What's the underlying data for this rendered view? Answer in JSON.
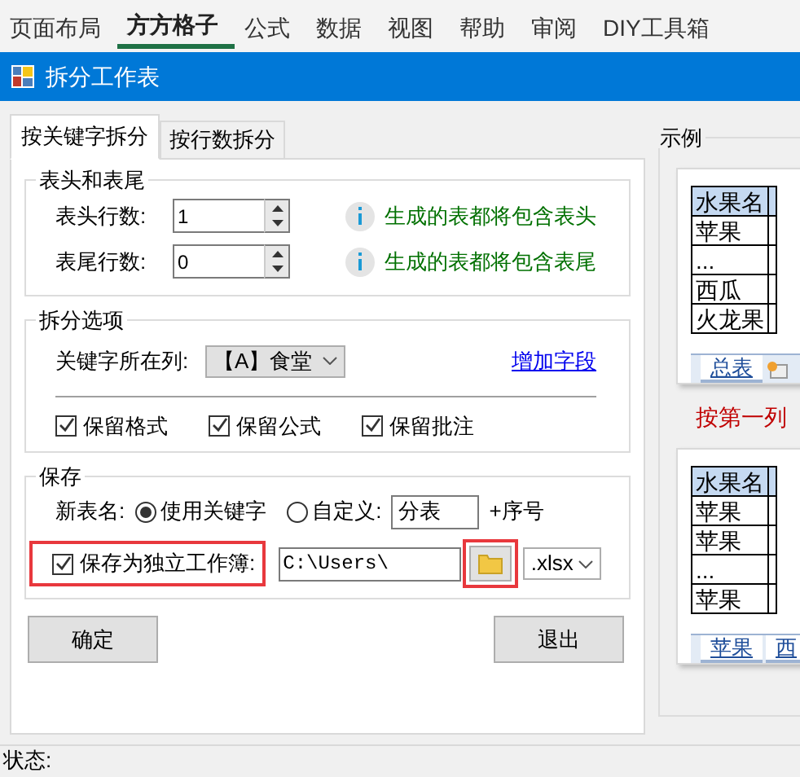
{
  "ribbon_tabs": [
    {
      "label": "页面布局",
      "selected": false
    },
    {
      "label": "方方格子",
      "selected": true
    },
    {
      "label": "公式",
      "selected": false
    },
    {
      "label": "数据",
      "selected": false
    },
    {
      "label": "视图",
      "selected": false
    },
    {
      "label": "帮助",
      "selected": false
    },
    {
      "label": "审阅",
      "selected": false
    },
    {
      "label": "DIY工具箱",
      "selected": false
    }
  ],
  "dialog": {
    "title": "拆分工作表"
  },
  "tabs": [
    {
      "label": "按关键字拆分",
      "selected": true
    },
    {
      "label": "按行数拆分",
      "selected": false
    }
  ],
  "header_footer": {
    "title": "表头和表尾",
    "rows": [
      {
        "label": "表头行数:",
        "value": "1",
        "hint": "生成的表都将包含表头"
      },
      {
        "label": "表尾行数:",
        "value": "0",
        "hint": "生成的表都将包含表尾"
      }
    ]
  },
  "split_options": {
    "title": "拆分选项",
    "key_column_label": "关键字所在列:",
    "key_column_value": "【A】食堂",
    "add_field_link": "增加字段",
    "checkboxes": [
      {
        "label": "保留格式",
        "checked": true
      },
      {
        "label": "保留公式",
        "checked": true
      },
      {
        "label": "保留批注",
        "checked": true
      }
    ]
  },
  "save": {
    "title": "保存",
    "new_name_label": "新表名:",
    "radios": [
      {
        "label": "使用关键字",
        "selected": true
      },
      {
        "label": "自定义:",
        "selected": false
      }
    ],
    "custom_name": "分表",
    "suffix": "+序号",
    "save_workbook": {
      "label": "保存为独立工作簿:",
      "checked": true,
      "highlighted": true
    },
    "path": "C:\\Users\\",
    "browse_highlighted": true,
    "extension": ".xlsx"
  },
  "buttons": [
    "确定",
    "退出"
  ],
  "status_label": "状态:",
  "example": {
    "title": "示例",
    "caption": "按第一列",
    "tables": [
      {
        "header": "水果名",
        "rows": [
          "苹果",
          "...",
          "西瓜",
          "火龙果"
        ],
        "sheet_tabs": [
          "总表"
        ]
      },
      {
        "header": "水果名",
        "rows": [
          "苹果",
          "苹果",
          "...",
          "苹果"
        ],
        "sheet_tabs": [
          "苹果",
          "西"
        ]
      }
    ]
  }
}
